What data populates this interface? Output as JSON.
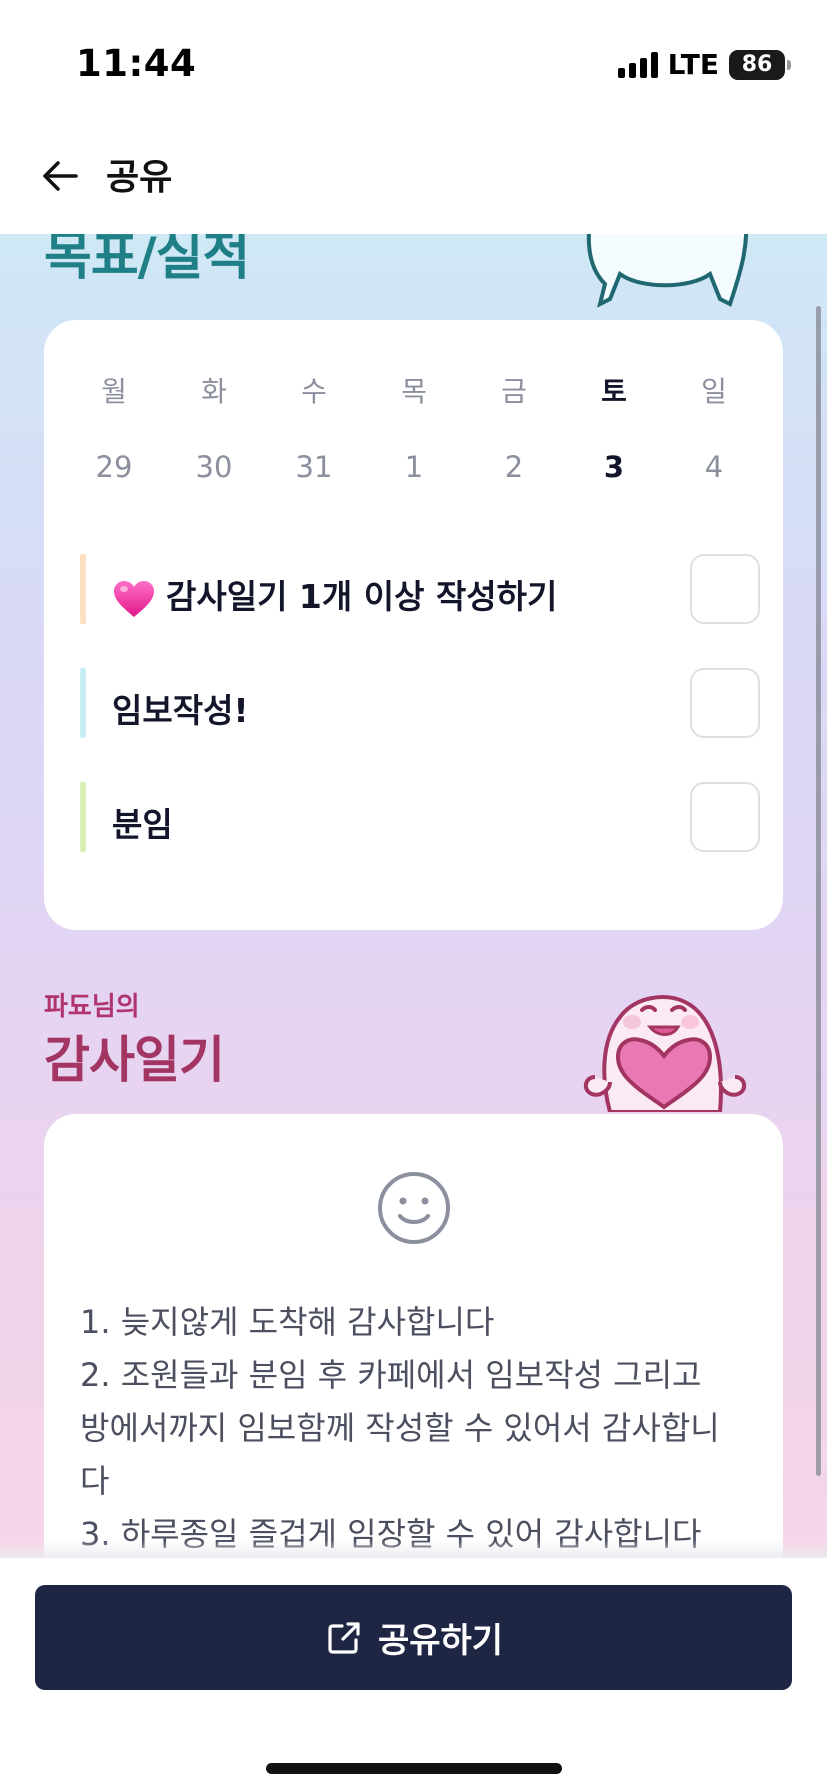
{
  "status_bar": {
    "time": "11:44",
    "network": "LTE",
    "battery": "86"
  },
  "nav": {
    "title": "공유",
    "back_icon": "arrow-left-icon"
  },
  "goals": {
    "title": "목표/실적",
    "week": {
      "days": [
        "월",
        "화",
        "수",
        "목",
        "금",
        "토",
        "일"
      ],
      "dates": [
        "29",
        "30",
        "31",
        "1",
        "2",
        "3",
        "4"
      ],
      "selected_index": 5
    },
    "items": [
      {
        "text": "감사일기 1개 이상 작성하기",
        "icon": "pink-heart-emoji",
        "color": "#fde0c2"
      },
      {
        "text": "임보작성!",
        "icon": "",
        "color": "#c7eef6"
      },
      {
        "text": "분임",
        "icon": "",
        "color": "#d8f0b6"
      }
    ]
  },
  "gratitude": {
    "subtitle": "파됴님의",
    "title": "감사일기",
    "mood_icon": "smile-face-icon",
    "lines": [
      "1. 늦지않게 도착해 감사합니다",
      "2. 조원들과 분임 후 카페에서 임보작성 그리고",
      "방에서까지 임보함께 작성할 수 있어서 감사합니",
      "다",
      "3. 하루종일 즐겁게 임장할 수 있어 감사합니다"
    ]
  },
  "share_button": {
    "label": "공유하기",
    "icon": "external-link-icon"
  },
  "colors": {
    "primary_dark": "#1e2644",
    "goal_title": "#1f7f86",
    "gratitude_title": "#a23562"
  }
}
